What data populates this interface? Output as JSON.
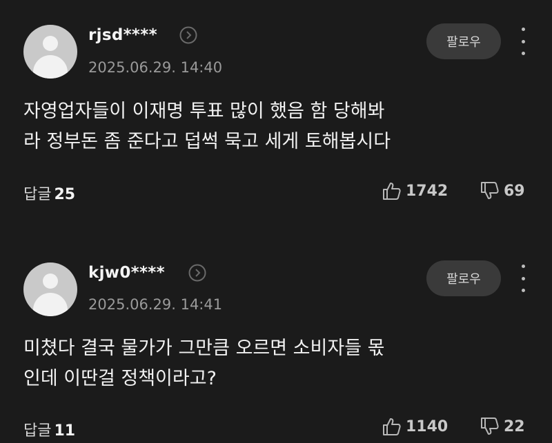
{
  "comments": [
    {
      "username": "rjsd****",
      "timestamp": "2025.06.29. 14:40",
      "follow_label": "팔로우",
      "lines": [
        "자영업자들이 이재명 투표 많이 했음 함 당해봐",
        "라 정부돈 좀 준다고 덥썩 묵고 세게 토해봅시다"
      ],
      "reply_label": "답글",
      "reply_count": "25",
      "likes": "1742",
      "dislikes": "69"
    },
    {
      "username": "kjw0****",
      "timestamp": "2025.06.29. 14:41",
      "follow_label": "팔로우",
      "lines": [
        "미쳤다 결국 물가가 그만큼 오르면 소비자들 몫",
        "인데 이딴걸 정책이라고?"
      ],
      "reply_label": "답글",
      "reply_count": "11",
      "likes": "1140",
      "dislikes": "22"
    }
  ]
}
